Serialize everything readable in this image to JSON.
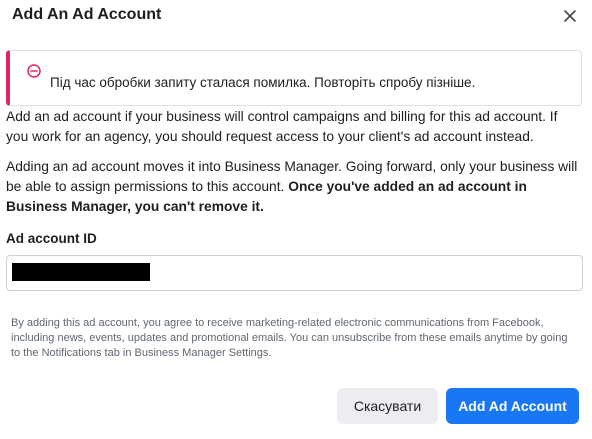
{
  "dialog": {
    "title": "Add An Ad Account",
    "close_icon": "close-icon"
  },
  "error": {
    "icon": "error-circle-icon",
    "message": "Під час обробки запиту сталася помилка. Повторіть спробу пізніше.",
    "accent_color": "#e0245e"
  },
  "body": {
    "paragraph1": "Add an ad account if your business will control campaigns and billing for this ad account. If you work for an agency, you should request access to your client's ad account instead.",
    "paragraph2_regular": "Adding an ad account moves it into Business Manager. Going forward, only your business will be able to assign permissions to this account. ",
    "paragraph2_bold": "Once you've added an ad account in Business Manager, you can't remove it."
  },
  "field": {
    "label": "Ad account ID",
    "value_redacted": true
  },
  "disclaimer": "By adding this ad account, you agree to receive marketing-related electronic communications from Facebook, including news, events, updates and promotional emails. You can unsubscribe from these emails anytime by going to the Notifications tab in Business Manager Settings.",
  "buttons": {
    "cancel": "Скасувати",
    "submit": "Add Ad Account",
    "primary_color": "#1877f2"
  }
}
